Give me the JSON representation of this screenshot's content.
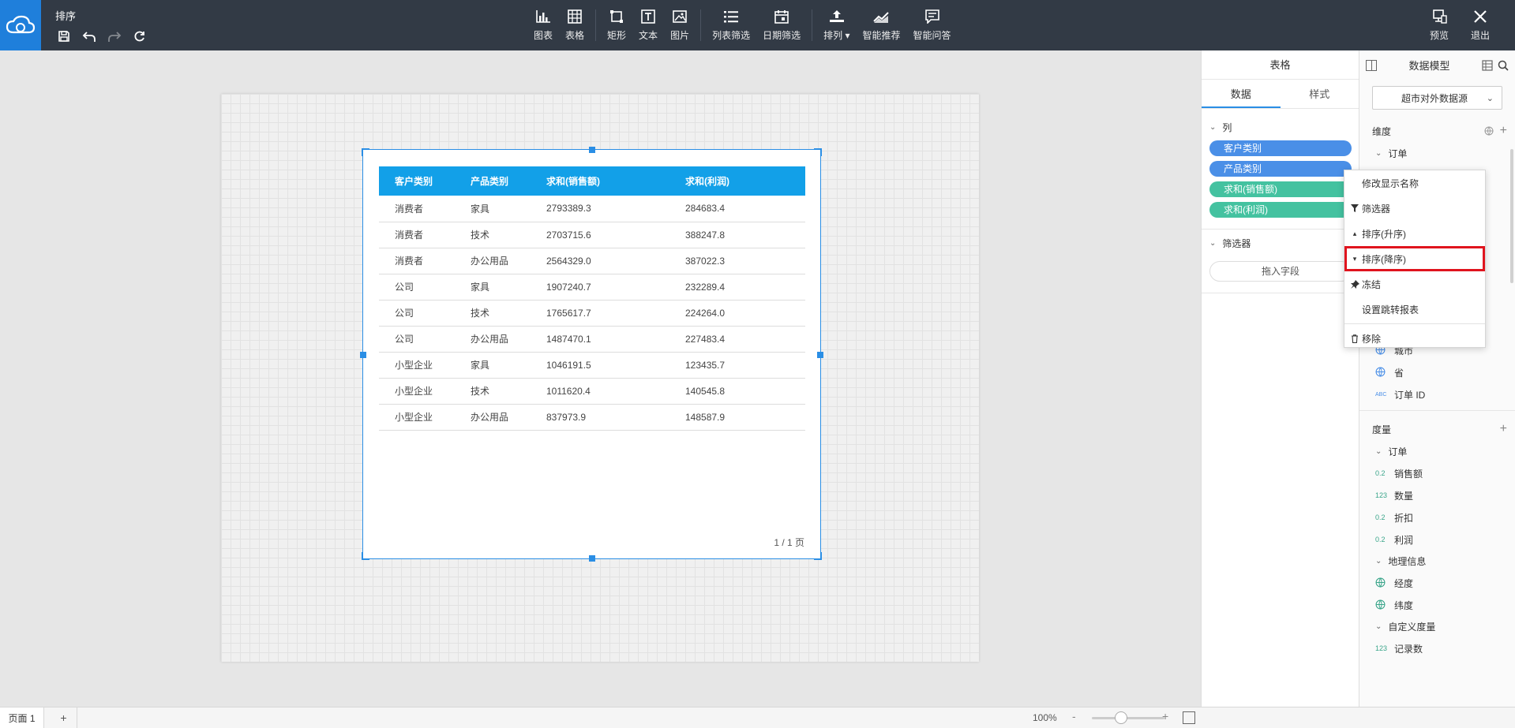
{
  "app": {
    "title": "排序"
  },
  "toolbar": {
    "tools": [
      {
        "key": "chart",
        "label": "图表"
      },
      {
        "key": "table",
        "label": "表格"
      },
      {
        "key": "rect",
        "label": "矩形"
      },
      {
        "key": "text",
        "label": "文本"
      },
      {
        "key": "image",
        "label": "图片"
      },
      {
        "key": "list-filter",
        "label": "列表筛选"
      },
      {
        "key": "date-filter",
        "label": "日期筛选"
      },
      {
        "key": "arrange",
        "label": "排列"
      },
      {
        "key": "smart-recommend",
        "label": "智能推荐"
      },
      {
        "key": "smart-qa",
        "label": "智能问答"
      }
    ],
    "preview_label": "预览",
    "exit_label": "退出"
  },
  "table": {
    "headers": [
      "客户类别",
      "产品类别",
      "求和(销售额)",
      "求和(利润)"
    ],
    "rows": [
      [
        "消费者",
        "家具",
        "2793389.3",
        "284683.4"
      ],
      [
        "消费者",
        "技术",
        "2703715.6",
        "388247.8"
      ],
      [
        "消费者",
        "办公用品",
        "2564329.0",
        "387022.3"
      ],
      [
        "公司",
        "家具",
        "1907240.7",
        "232289.4"
      ],
      [
        "公司",
        "技术",
        "1765617.7",
        "224264.0"
      ],
      [
        "公司",
        "办公用品",
        "1487470.1",
        "227483.4"
      ],
      [
        "小型企业",
        "家具",
        "1046191.5",
        "123435.7"
      ],
      [
        "小型企业",
        "技术",
        "1011620.4",
        "140545.8"
      ],
      [
        "小型企业",
        "办公用品",
        "837973.9",
        "148587.9"
      ]
    ],
    "pager": "1 / 1 页"
  },
  "config_panel": {
    "title": "表格",
    "tabs": [
      "数据",
      "样式"
    ],
    "columns_label": "列",
    "columns": [
      {
        "label": "客户类别",
        "kind": "dim"
      },
      {
        "label": "产品类别",
        "kind": "dim"
      },
      {
        "label": "求和(销售额)",
        "kind": "meas"
      },
      {
        "label": "求和(利润)",
        "kind": "meas"
      }
    ],
    "filter_label": "筛选器",
    "drop_placeholder": "拖入字段"
  },
  "context_menu": {
    "items": [
      {
        "label": "修改显示名称",
        "icon": "none"
      },
      {
        "label": "筛选器",
        "icon": "filter-icon"
      },
      {
        "label": "排序(升序)",
        "icon": "sort-asc-icon"
      },
      {
        "label": "排序(降序)",
        "icon": "sort-desc-icon",
        "highlight": true
      },
      {
        "label": "冻结",
        "icon": "pin-icon"
      },
      {
        "label": "设置跳转报表",
        "icon": "none"
      },
      {
        "label": "移除",
        "icon": "trash-icon"
      }
    ]
  },
  "data_model": {
    "title": "数据模型",
    "datasource": "超市对外数据源",
    "dimension_label": "维度",
    "dim_group": "订单",
    "dim_fields": [
      {
        "label": "城市",
        "type": "geo"
      },
      {
        "label": "省",
        "type": "geo"
      },
      {
        "label": "订单 ID",
        "type": "ABC"
      }
    ],
    "measure_label": "度量",
    "measure_groups": [
      {
        "name": "订单",
        "fields": [
          {
            "label": "销售额",
            "type": "0.2"
          },
          {
            "label": "数量",
            "type": "123"
          },
          {
            "label": "折扣",
            "type": "0.2"
          },
          {
            "label": "利润",
            "type": "0.2"
          }
        ]
      },
      {
        "name": "地理信息",
        "fields": [
          {
            "label": "经度",
            "type": "geo"
          },
          {
            "label": "纬度",
            "type": "geo"
          }
        ]
      },
      {
        "name": "自定义度量",
        "fields": [
          {
            "label": "记录数",
            "type": "123"
          }
        ]
      }
    ]
  },
  "bottom": {
    "page_tab": "页面 1",
    "add": "+",
    "zoom": "100%",
    "zoom_minus": "-",
    "zoom_plus": "+"
  },
  "colors": {
    "accent": "#2a8ee5",
    "header": "#12a0e8",
    "dim_pill": "#4a8fe7",
    "meas_pill": "#44c2a0",
    "highlight": "#e0141e",
    "topbar": "#323a45"
  }
}
